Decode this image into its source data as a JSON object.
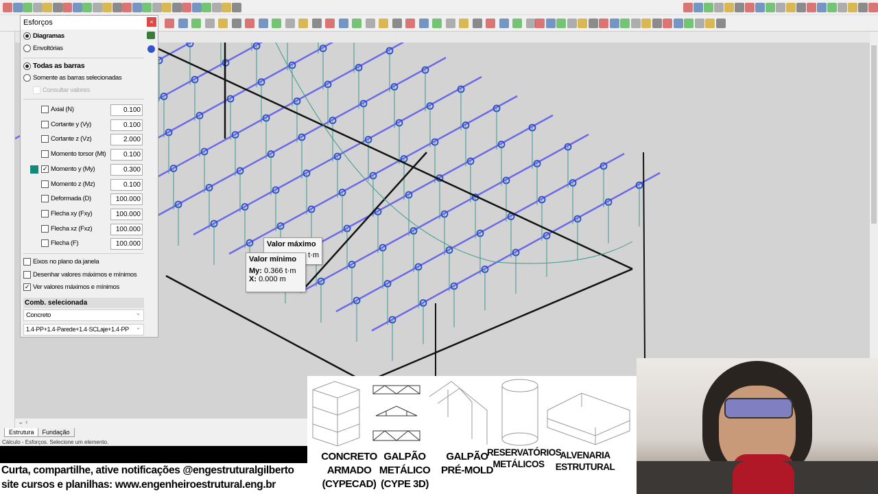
{
  "panel": {
    "title": "Esforços",
    "close_label": "×",
    "mode_options": [
      "Diagramas",
      "Envoltórias"
    ],
    "bar_options": [
      "Todas as barras",
      "Somente as barras selecionadas"
    ],
    "consult_values": "Consultar valores",
    "efforts": [
      {
        "label": "Axial (N)",
        "value": "0.100",
        "checked": false
      },
      {
        "label": "Cortante y (Vy)",
        "value": "0.100",
        "checked": false
      },
      {
        "label": "Cortante z (Vz)",
        "value": "2.000",
        "checked": false
      },
      {
        "label": "Momento torsor (Mt)",
        "value": "0.100",
        "checked": false
      },
      {
        "label": "Momento y (My)",
        "value": "0.300",
        "checked": true
      },
      {
        "label": "Momento z (Mz)",
        "value": "0.100",
        "checked": false
      },
      {
        "label": "Deformada (D)",
        "value": "100.000",
        "checked": false
      },
      {
        "label": "Flecha xy (Fxy)",
        "value": "100.000",
        "checked": false
      },
      {
        "label": "Flecha xz (Fxz)",
        "value": "100.000",
        "checked": false
      },
      {
        "label": "Flecha (F)",
        "value": "100.000",
        "checked": false
      }
    ],
    "options": [
      {
        "label": "Eixos no plano da janela",
        "checked": false
      },
      {
        "label": "Desenhar valores máximos e mínimos",
        "checked": false
      },
      {
        "label": "Ver valores máximos e mínimos",
        "checked": true
      }
    ],
    "comb_header": "Comb. selecionada",
    "comb_type": "Concreto",
    "comb_value": "1.4·PP+1.4·Parede+1.4·SCLaje+1.4·PP",
    "diagram_color": "#138a78"
  },
  "tooltips": {
    "max_title": "Valor máximo",
    "max_partial": "t·m",
    "min_title": "Valor mínimo",
    "min_my_label": "My:",
    "min_my_value": "0.366 t·m",
    "min_x_label": "X:",
    "min_x_value": "0.000 m"
  },
  "tabs": [
    "Estrutura",
    "Fundação"
  ],
  "status": "Cálculo - Esforços. Selecione um elemento.",
  "promo": {
    "line1": "Curta, compartilhe, ative notificações @engestruturalgilberto",
    "line2": "site cursos e planilhas: www.engenheiroestrutural.eng.br"
  },
  "courses": [
    {
      "l1": "CONCRETO",
      "l2": "ARMADO",
      "l3": "(CYPECAD)"
    },
    {
      "l1": "GALPÃO",
      "l2": "METÁLICO",
      "l3": "(CYPE 3D)"
    },
    {
      "l1": "GALPÃO",
      "l2": "PRÉ-MOLD",
      "l3": ""
    },
    {
      "l1": "RESERVATÓRIOS",
      "l2": "METÁLICOS",
      "l3": ""
    },
    {
      "l1": "ALVENARIA",
      "l2": "ESTRUTURAL",
      "l3": ""
    }
  ]
}
